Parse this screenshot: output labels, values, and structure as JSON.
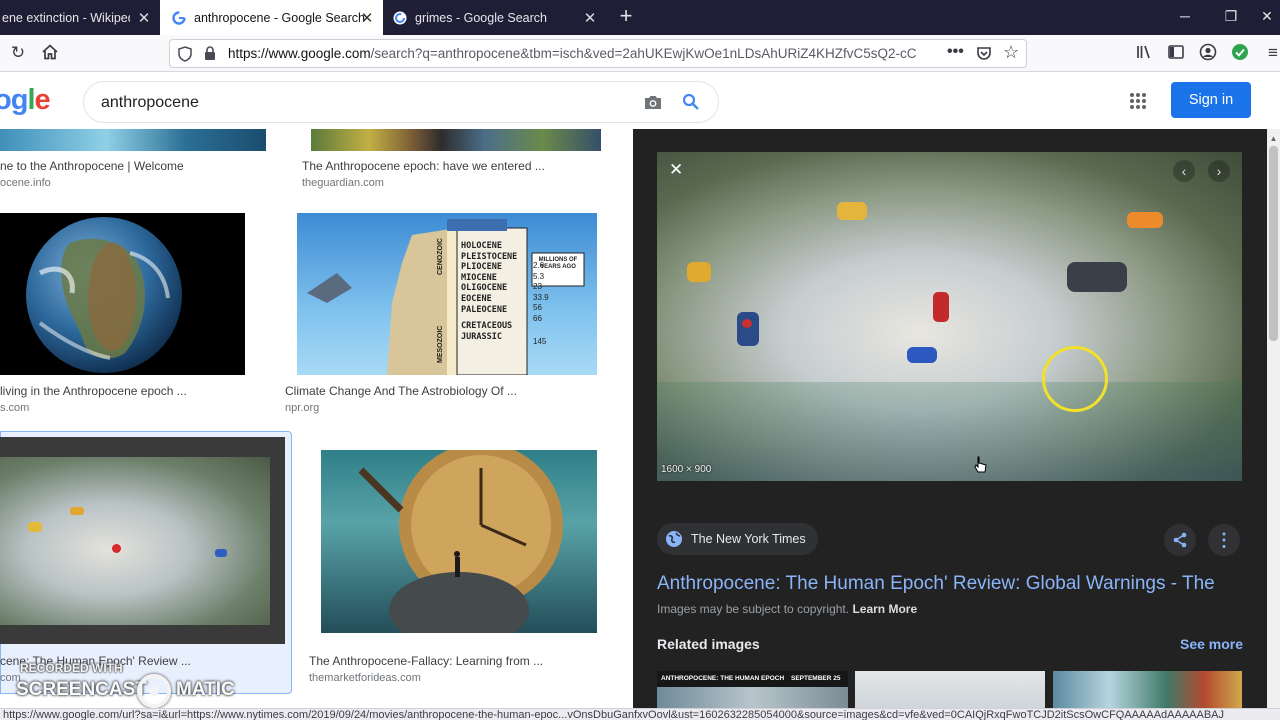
{
  "browser": {
    "tabs": [
      {
        "title": "ene extinction - Wikipedia",
        "active": false
      },
      {
        "title": "anthropocene - Google Search",
        "active": true
      },
      {
        "title": "grimes - Google Search",
        "active": false
      }
    ],
    "url_prefix": "https://www.google.com",
    "url_rest": "/search?q=anthropocene&tbm=isch&ved=2ahUKEwjKwOe1nLDsAhURiZ4KHZfvC5sQ2-cC",
    "status_url": "https://www.google.com/url?sa=i&url=https://www.nytimes.com/2019/09/24/movies/anthropocene-the-human-epoc...vOnsDbuGanfxvOovl&ust=1602632285054000&source=images&cd=vfe&ved=0CAIQjRxqFwoTCJD2itScsOwCFQAAAAAdAAAAABAJ"
  },
  "google": {
    "logo_letters": [
      "o",
      "g",
      "l",
      "e"
    ],
    "query": "anthropocene",
    "signin_label": "Sign in"
  },
  "results": [
    {
      "title": "ne to the Anthropocene | Welcome",
      "source": "ocene.info"
    },
    {
      "title": "The Anthropocene epoch: have we entered ...",
      "source": "theguardian.com"
    },
    {
      "title": "living in the Anthropocene epoch ...",
      "source": "s.com"
    },
    {
      "title": "Climate Change And The Astrobiology Of ...",
      "source": "npr.org"
    },
    {
      "title": "cene: The Human Epoch' Review ...",
      "source": "com"
    },
    {
      "title": "The Anthropocene-Fallacy: Learning from ...",
      "source": "themarketforideas.com"
    }
  ],
  "geo_chart": {
    "eras": [
      "HOLOCENE",
      "PLEISTOCENE",
      "PLIOCENE",
      "MIOCENE",
      "OLIGOCENE",
      "EOCENE",
      "PALEOCENE",
      "CRETACEOUS",
      "JURASSIC"
    ],
    "era_groups": [
      "CENOZOIC",
      "MESOZOIC"
    ],
    "ages": [
      "2.6",
      "5.3",
      "23",
      "33.9",
      "56",
      "66",
      "145"
    ],
    "millions_label": "MILLIONS OF YEARS AGO"
  },
  "panel": {
    "dimensions": "1600 × 900",
    "source_name": "The New York Times",
    "headline": "Anthropocene: The Human Epoch' Review: Global Warnings - The",
    "copyright_text": "Images may be subject to copyright.",
    "learn_more": "Learn More",
    "related_label": "Related images",
    "see_more": "See more",
    "related_caption": "ANTHROPOCENE: THE HUMAN EPOCH",
    "related_date": "SEPTEMBER 25"
  },
  "watermark": {
    "recorded": "RECORDED WITH",
    "brand_left": "SCREENCAST",
    "brand_right": "MATIC"
  },
  "colors": {
    "tabbar": "#1f1e36",
    "google_blue": "#4285f4",
    "google_red": "#ea4335",
    "google_yellow": "#fbbc05",
    "google_green": "#34a853",
    "link_blue": "#8ab4f8",
    "signin_blue": "#1a73e8",
    "panel_bg": "#222222"
  }
}
